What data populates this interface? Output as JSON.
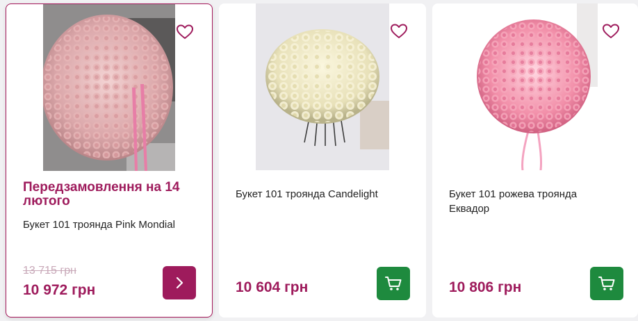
{
  "products": [
    {
      "name": "Букет 101 троянда Pink Mondial",
      "badge": "Передзамовлення на 14 лютого",
      "old_price": "13 715 грн",
      "price": "10 972 грн",
      "image": "pink-roses-bouquet"
    },
    {
      "name": "Букет 101 троянда Candelight",
      "price": "10 604 грн",
      "image": "white-roses-bouquet"
    },
    {
      "name": "Букет 101 рожева троянда Еквадор",
      "price": "10 806 грн",
      "image": "pink-roses-ball-bouquet"
    }
  ],
  "icons": {
    "favorite": "heart-icon",
    "open": "chevron-right-icon",
    "cart": "shopping-cart-icon"
  },
  "colors": {
    "accent": "#9e1b5c",
    "cart_button": "#1e8a3e",
    "old_price": "#c8a8b8",
    "background": "#f1f1f3"
  }
}
